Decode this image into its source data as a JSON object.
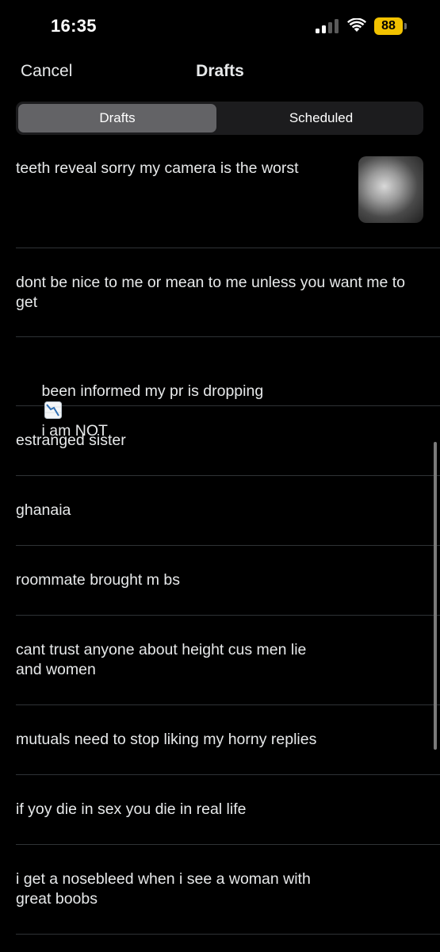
{
  "status_bar": {
    "time": "16:35",
    "battery_level": "88",
    "icons": [
      "signal-icon",
      "wifi-icon",
      "battery-icon"
    ]
  },
  "header": {
    "cancel_label": "Cancel",
    "title": "Drafts"
  },
  "tabs": [
    {
      "label": "Drafts",
      "active": true
    },
    {
      "label": "Scheduled",
      "active": false
    }
  ],
  "drafts": [
    {
      "text": "teeth reveal sorry my camera is the worst",
      "has_thumbnail": true
    },
    {
      "text": "dont be nice to me or mean to me unless you want me to get",
      "has_thumbnail": false
    },
    {
      "text_before": "been informed my pr is dropping",
      "emoji": "chart-decreasing-icon",
      "text_after": "i am NOT",
      "has_thumbnail": false
    },
    {
      "text": "estranged sister",
      "has_thumbnail": false
    },
    {
      "text": "ghanaia",
      "has_thumbnail": false
    },
    {
      "text": "roommate brought m bs",
      "has_thumbnail": false
    },
    {
      "text": "cant trust anyone about height cus men lie\nand women",
      "has_thumbnail": false
    },
    {
      "text": "mutuals need to stop liking my horny replies",
      "has_thumbnail": false
    },
    {
      "text": "if yoy die in sex you die in real life",
      "has_thumbnail": false
    },
    {
      "text": "i get a nosebleed when i see a woman with\ngreat boobs",
      "has_thumbnail": false
    }
  ],
  "colors": {
    "background": "#000000",
    "text": "#e7e9ea",
    "divider": "#2f3336",
    "segment_bg": "#1c1c1e",
    "segment_active": "#636366",
    "battery": "#f2c200"
  }
}
